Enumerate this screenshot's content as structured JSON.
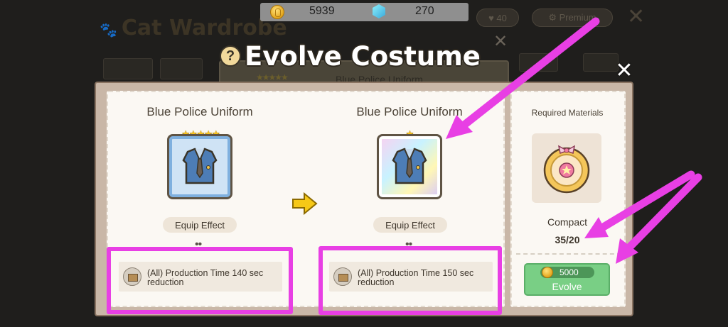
{
  "background": {
    "title": "Cat Wardrobe",
    "panel_text": "Blue Police Uniform"
  },
  "currency": {
    "gold": "5939",
    "gems": "270"
  },
  "modal": {
    "title": "Evolve Costume",
    "before": {
      "name": "Blue Police Uniform",
      "stars": 5,
      "equip_label": "Equip Effect",
      "effect_text": "(All) Production Time 140 sec reduction"
    },
    "after": {
      "name": "Blue Police Uniform",
      "stars": 1,
      "equip_label": "Equip Effect",
      "effect_text": "(All) Production Time 150 sec reduction"
    },
    "materials": {
      "label": "Required Materials",
      "item_name": "Compact",
      "count": "35/20"
    },
    "evolve": {
      "cost": "5000",
      "label": "Evolve"
    }
  },
  "colors": {
    "annotation": "#e83fe4",
    "evolve_button": "#79cf85",
    "title_text": "#ffffff"
  }
}
